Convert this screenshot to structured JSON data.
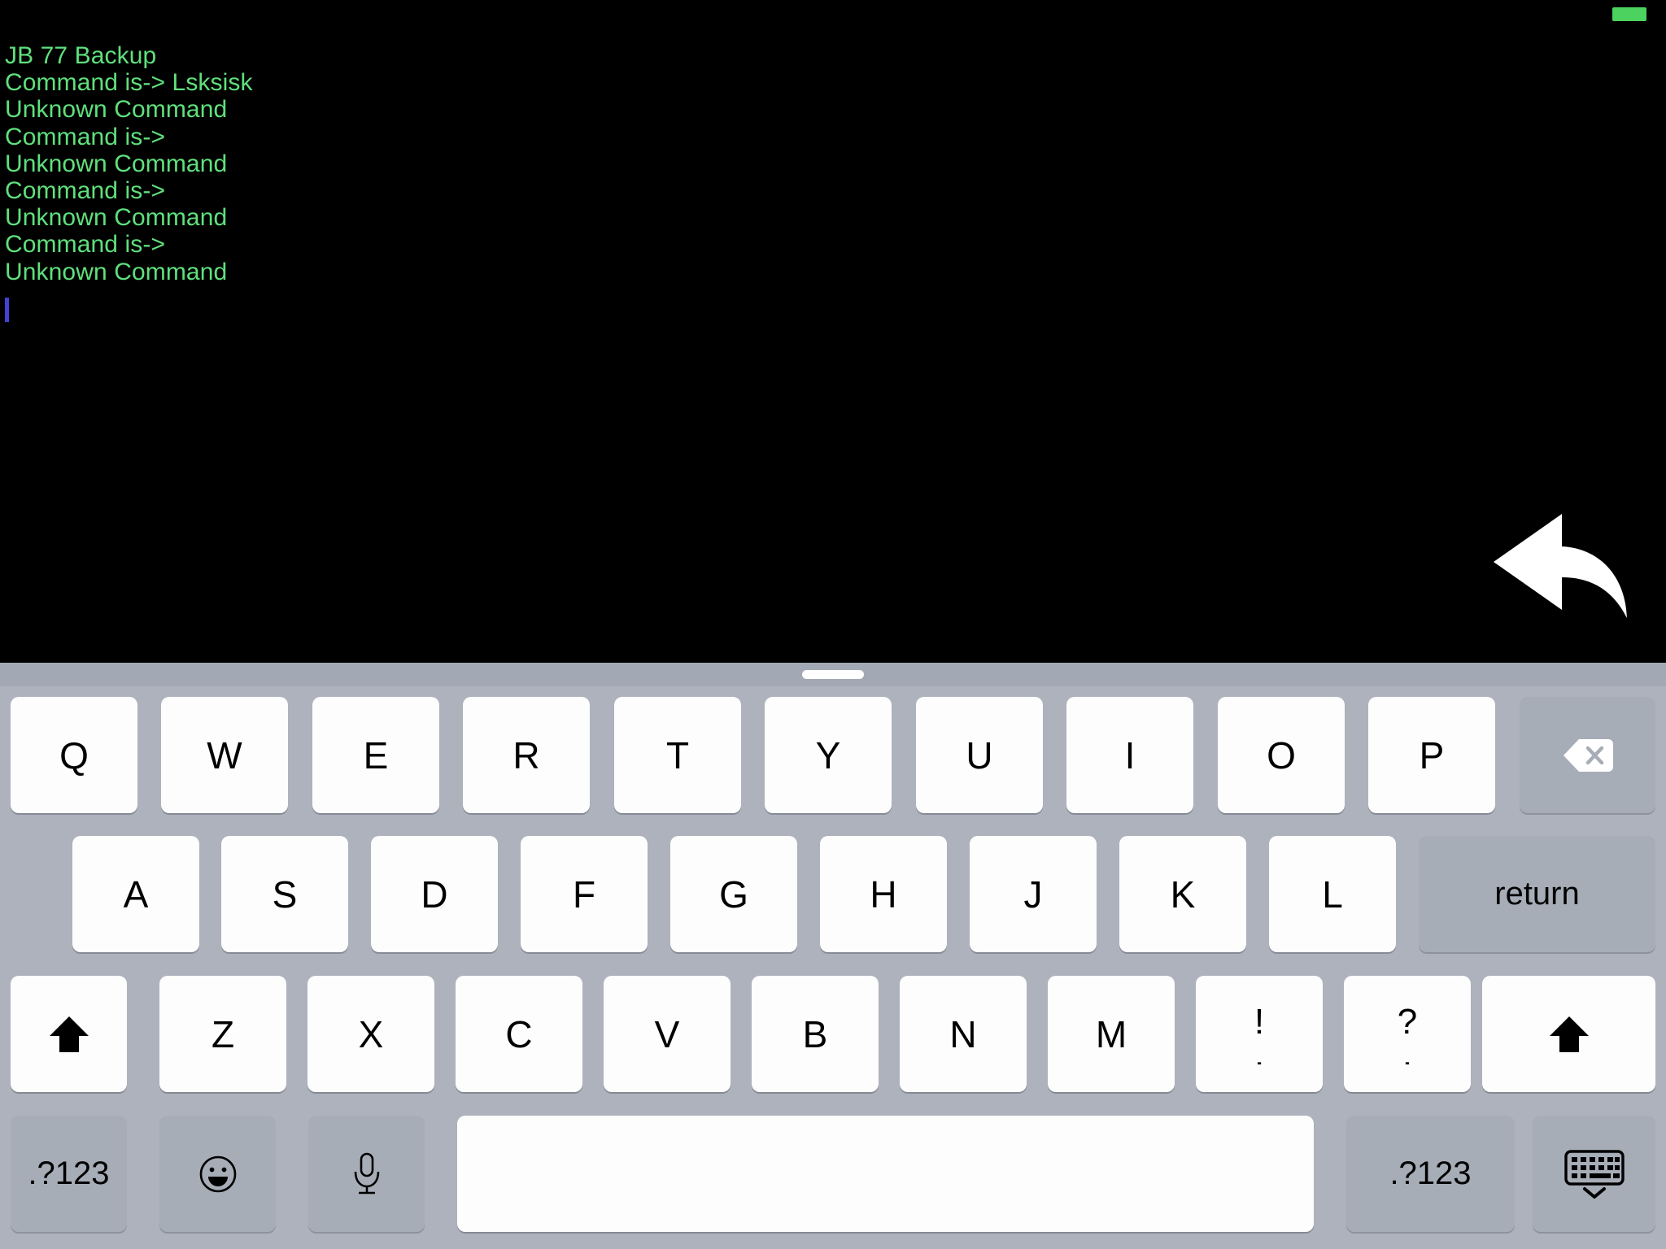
{
  "status_bar": {
    "battery_icon": "battery-full-icon",
    "battery_color": "#4CD35F"
  },
  "console": {
    "text_color": "#5FE07C",
    "background_color": "#000000",
    "cursor_color": "#4242D8",
    "lines": [
      "JB 77 Backup",
      "Command is-> Lsksisk",
      "Unknown Command",
      "Command is->",
      "Unknown Command",
      "Command is->",
      "Unknown Command",
      "Command is->",
      "Unknown Command"
    ]
  },
  "overlay": {
    "reply_arrow_icon": "reply-arrow-icon",
    "reply_arrow_color": "#FFFFFF"
  },
  "keyboard": {
    "background_color": "#ADB2BC",
    "key_color": "#FDFDFD",
    "modifier_key_color": "#A7ADB7",
    "row1": [
      {
        "label": "Q",
        "name": "key-q"
      },
      {
        "label": "W",
        "name": "key-w"
      },
      {
        "label": "E",
        "name": "key-e"
      },
      {
        "label": "R",
        "name": "key-r"
      },
      {
        "label": "T",
        "name": "key-t"
      },
      {
        "label": "Y",
        "name": "key-y"
      },
      {
        "label": "U",
        "name": "key-u"
      },
      {
        "label": "I",
        "name": "key-i"
      },
      {
        "label": "O",
        "name": "key-o"
      },
      {
        "label": "P",
        "name": "key-p"
      }
    ],
    "backspace": {
      "label": "",
      "name": "key-backspace",
      "icon": "backspace-delete-icon"
    },
    "row2": [
      {
        "label": "A",
        "name": "key-a"
      },
      {
        "label": "S",
        "name": "key-s"
      },
      {
        "label": "D",
        "name": "key-d"
      },
      {
        "label": "F",
        "name": "key-f"
      },
      {
        "label": "G",
        "name": "key-g"
      },
      {
        "label": "H",
        "name": "key-h"
      },
      {
        "label": "J",
        "name": "key-j"
      },
      {
        "label": "K",
        "name": "key-k"
      },
      {
        "label": "L",
        "name": "key-l"
      }
    ],
    "return": {
      "label": "return",
      "name": "key-return"
    },
    "row3": [
      {
        "label": "Z",
        "name": "key-z"
      },
      {
        "label": "X",
        "name": "key-x"
      },
      {
        "label": "C",
        "name": "key-c"
      },
      {
        "label": "V",
        "name": "key-v"
      },
      {
        "label": "B",
        "name": "key-b"
      },
      {
        "label": "N",
        "name": "key-n"
      },
      {
        "label": "M",
        "name": "key-m"
      }
    ],
    "shift_left": {
      "name": "key-shift-left",
      "icon": "shift-arrow-up-icon"
    },
    "shift_right": {
      "name": "key-shift-right",
      "icon": "shift-arrow-up-icon"
    },
    "punct_exclaim": {
      "top": "!",
      "bottom": ",",
      "name": "key-exclaim-comma"
    },
    "punct_question": {
      "top": "?",
      "bottom": ".",
      "name": "key-question-period"
    },
    "numeric_left": {
      "label": ".?123",
      "name": "key-numeric-left"
    },
    "numeric_right": {
      "label": ".?123",
      "name": "key-numeric-right"
    },
    "emoji": {
      "name": "key-emoji",
      "icon": "smiley-face-icon"
    },
    "dictation": {
      "name": "key-dictation",
      "icon": "microphone-icon"
    },
    "space": {
      "label": "",
      "name": "key-space"
    },
    "dismiss": {
      "name": "key-hide-keyboard",
      "icon": "hide-keyboard-icon"
    },
    "drag_handle": {
      "name": "keyboard-drag-handle"
    }
  }
}
